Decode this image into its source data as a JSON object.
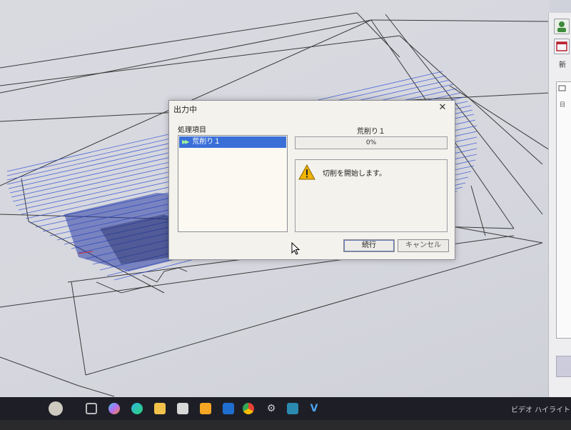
{
  "dialog": {
    "title": "出力中",
    "close_glyph": "✕",
    "list_label": "処理項目",
    "items": [
      {
        "label": "荒削り１"
      }
    ],
    "current_item": "荒削り１",
    "progress": {
      "text": "0%",
      "value": 0
    },
    "message": "切削を開始します。",
    "buttons": {
      "continue": "続行",
      "cancel": "キャンセル"
    }
  },
  "side_panel": {
    "label": "新",
    "tree_text": "日",
    "icons": [
      "person-icon",
      "window-icon"
    ]
  },
  "taskbar": {
    "right_text": "ビデオ ハイライト",
    "icons": [
      "task-view-icon",
      "copilot-icon",
      "edge-icon",
      "file-explorer-icon",
      "calendar-icon",
      "media-icon",
      "outlook-icon",
      "chrome-icon",
      "settings-icon",
      "cam-app-icon",
      "v-app-icon"
    ]
  },
  "colors": {
    "toolpath": "#2f4fd6",
    "selection": "#3a6fd8",
    "progress_fill": "#45b649",
    "warning": "#f0b400"
  }
}
